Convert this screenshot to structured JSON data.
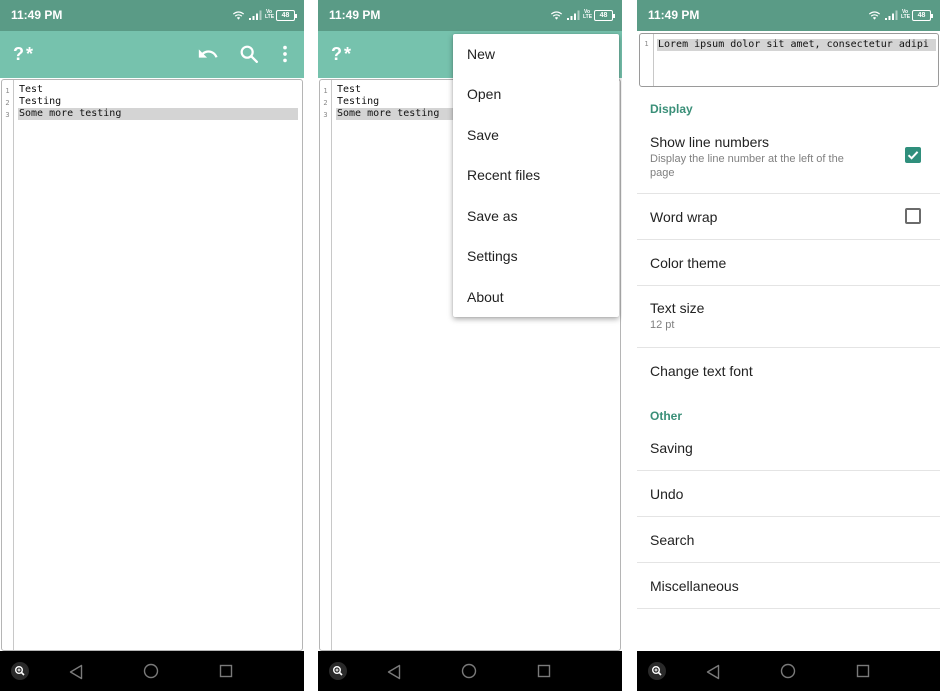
{
  "status_bar": {
    "time": "11:49 PM",
    "volte": "Vo LTE",
    "battery": "48"
  },
  "app": {
    "title": "?*"
  },
  "editor": {
    "lines": [
      {
        "number": "1",
        "text": "Test"
      },
      {
        "number": "2",
        "text": "Testing"
      },
      {
        "number": "3",
        "text": "Some more testing"
      }
    ],
    "selected_line": "3"
  },
  "toolbar": {
    "undo_icon": "undo-icon",
    "search_icon": "search-icon",
    "overflow_icon": "more-vert-icon"
  },
  "overflow_menu": {
    "items": [
      {
        "label": "New"
      },
      {
        "label": "Open"
      },
      {
        "label": "Save"
      },
      {
        "label": "Recent files"
      },
      {
        "label": "Save as"
      },
      {
        "label": "Settings"
      },
      {
        "label": "About"
      }
    ]
  },
  "settings": {
    "preview": {
      "line_number": "1",
      "text": "Lorem ipsum dolor sit amet, consectetur adipi"
    },
    "sections": [
      {
        "header": "Display",
        "items": [
          {
            "title": "Show line numbers",
            "summary": "Display the line number at the left of the page",
            "checkbox": true,
            "checked": true
          },
          {
            "title": "Word wrap",
            "summary": "",
            "checkbox": true,
            "checked": false
          },
          {
            "title": "Color theme",
            "summary": ""
          },
          {
            "title": "Text size",
            "summary": "12 pt"
          },
          {
            "title": "Change text font",
            "summary": ""
          }
        ]
      },
      {
        "header": "Other",
        "items": [
          {
            "title": "Saving",
            "summary": ""
          },
          {
            "title": "Undo",
            "summary": ""
          },
          {
            "title": "Search",
            "summary": ""
          },
          {
            "title": "Miscellaneous",
            "summary": ""
          }
        ]
      }
    ]
  },
  "nav_bar": {
    "buttons": [
      "zoom-icon",
      "back-icon",
      "home-icon",
      "recents-icon"
    ]
  },
  "colors": {
    "status_bar": "#5a9b86",
    "app_bar": "#76c2ad",
    "accent": "#2f8f7c",
    "section_header": "#3a8f78",
    "selection": "#d4d4d4"
  }
}
